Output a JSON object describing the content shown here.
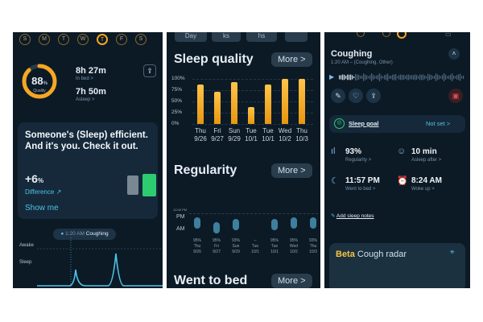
{
  "panel1": {
    "days": [
      "S",
      "M",
      "T",
      "W",
      "T",
      "F",
      "S"
    ],
    "sleep_score": "88",
    "score_unit": "%",
    "score_label": "Quality",
    "time_in_bed": "8h 27m",
    "time_in_bed_label": "In bed >",
    "time_asleep": "7h 50m",
    "time_asleep_label": "Asleep >",
    "promo_text": "Someone's (Sleep) efficient. And it's you. Check it out.",
    "difference_value": "+6",
    "difference_unit": "%",
    "difference_label": "Difference",
    "show_me": "Show me",
    "event_time": "1:20 AM",
    "event_name": "Coughing",
    "y_awake": "Awake",
    "y_sleep": "Sleep",
    "ring_fraction": 0.88,
    "colors": {
      "ring": "#f5a623",
      "accent": "#4fc3e8",
      "green": "#2ecc71",
      "gray": "#7a8894"
    }
  },
  "panel2": {
    "tabs": [
      "Day",
      "ks",
      "hs",
      ""
    ],
    "sleep_quality_title": "Sleep quality",
    "more_label": "More >",
    "regularity_title": "Regularity",
    "went_to_bed_title": "Went to bed",
    "regularity_y_labels": [
      "12:00 PM",
      "PM",
      "AM"
    ],
    "regularity_values": [
      "95%",
      "95%",
      "93%",
      "–",
      "95%",
      "95%",
      "93%"
    ],
    "regularity_days": [
      "Thu",
      "Fri",
      "Sun",
      "Tue",
      "Tue",
      "Wed",
      "Thu"
    ],
    "regularity_dates": [
      "9/26",
      "9/27",
      "9/29",
      "10/1",
      "10/1",
      "10/2",
      "10/3"
    ]
  },
  "panel3": {
    "title": "Coughing",
    "subtitle": "1:20 AM – (Coughing, Other)",
    "sleep_goal_label": "Sleep goal",
    "sleep_goal_value": "Not set >",
    "regularity_value": "93%",
    "regularity_label": "Regularity >",
    "asleep_after_value": "10 min",
    "asleep_after_label": "Asleep after >",
    "bed_time_value": "11:57 PM",
    "bed_time_label": "Went to bed >",
    "wake_time_value": "8:24 AM",
    "wake_time_label": "Woke up >",
    "add_notes": "Add sleep notes",
    "beta_label": "Beta",
    "cough_radar_label": "Cough radar",
    "colors": {
      "green": "#2ecc71",
      "blue": "#7fb8e8",
      "red": "#e05050"
    }
  },
  "chart_data": {
    "type": "bar",
    "categories": [
      "Thu 9/26",
      "Fri 9/27",
      "Sun 9/29",
      "Tue 10/1",
      "Tue 10/1",
      "Wed 10/2",
      "Thu 10/3"
    ],
    "values": [
      88,
      72,
      93,
      37,
      88,
      100,
      100
    ],
    "title": "Sleep quality",
    "y_ticks": [
      "100%",
      "75%",
      "50%",
      "25%",
      "0%"
    ],
    "ylim": [
      0,
      100
    ],
    "grid": true
  }
}
